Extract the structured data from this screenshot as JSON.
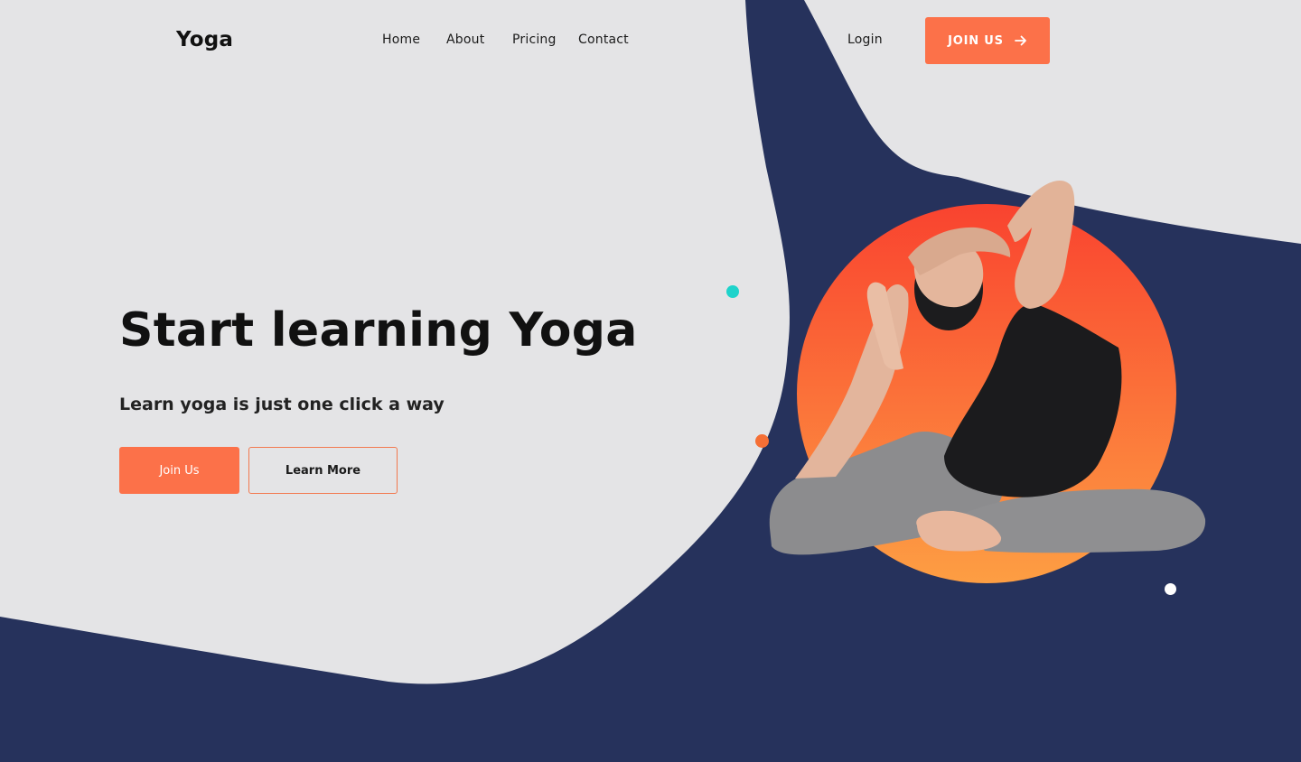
{
  "header": {
    "logo": "Yoga",
    "nav": [
      "Home",
      "About",
      "Pricing",
      "Contact"
    ],
    "login": "Login",
    "cta": "JOIN US"
  },
  "hero": {
    "title": "Start learning Yoga",
    "subtitle": "Learn yoga is just one click a way",
    "primary_button": "Join Us",
    "secondary_button": "Learn More"
  },
  "colors": {
    "accent": "#fc7149",
    "navy": "#26325c",
    "background": "#e4e4e6",
    "teal_dot": "#1ed3cb",
    "orange_dot": "#f56f35",
    "white_dot": "#ffffff",
    "circle_top": "#f9432f",
    "circle_bottom": "#fd9e43"
  },
  "icons": {
    "cta_arrow": "arrow-right-icon"
  }
}
